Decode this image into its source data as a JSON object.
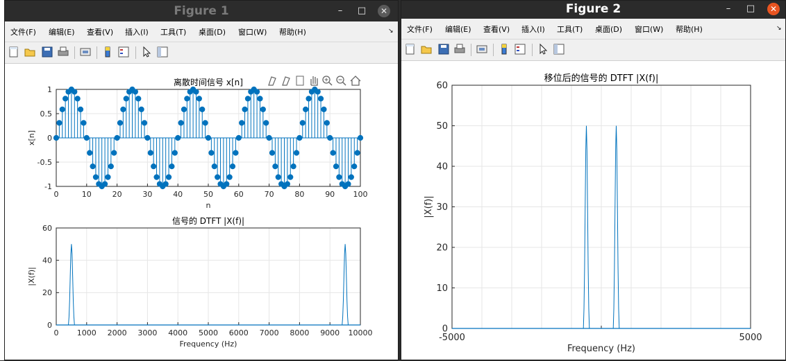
{
  "figure1": {
    "title": "Figure 1",
    "menu": [
      "文件(F)",
      "编辑(E)",
      "查看(V)",
      "插入(I)",
      "工具(T)",
      "桌面(D)",
      "窗口(W)",
      "帮助(H)"
    ],
    "toolbar_icons": [
      "new-figure-icon",
      "open-file-icon",
      "save-icon",
      "print-icon",
      "link-icon",
      "colorbar-icon",
      "legend-icon",
      "pointer-icon",
      "property-editor-icon"
    ],
    "axes_toolbar_icons": [
      "brush-icon",
      "data-tip-icon",
      "export-icon",
      "pan-icon",
      "zoom-in-icon",
      "zoom-out-icon",
      "home-icon"
    ],
    "title_color": "#7a7a7a"
  },
  "figure2": {
    "title": "Figure 2",
    "menu": [
      "文件(F)",
      "编辑(E)",
      "查看(V)",
      "插入(I)",
      "工具(T)",
      "桌面(D)",
      "窗口(W)",
      "帮助(H)"
    ],
    "toolbar_icons": [
      "new-figure-icon",
      "open-file-icon",
      "save-icon",
      "print-icon",
      "link-icon",
      "colorbar-icon",
      "legend-icon",
      "pointer-icon",
      "property-editor-icon"
    ],
    "title_color": "#ffffff"
  },
  "chart_data": [
    {
      "type": "stem",
      "title": "离散时间信号 x[n]",
      "xlabel": "n",
      "ylabel": "x[n]",
      "xlim": [
        0,
        100
      ],
      "ylim": [
        -1,
        1
      ],
      "xticks": [
        0,
        10,
        20,
        30,
        40,
        50,
        60,
        70,
        80,
        90,
        100
      ],
      "yticks": [
        -1,
        -0.5,
        0,
        0.5,
        1
      ],
      "ytick_labels": [
        "-1",
        "-0.5",
        "0",
        "0.5",
        "1"
      ],
      "signal": "sin(2*pi*0.05*n)",
      "x": [
        0,
        1,
        2,
        3,
        4,
        5,
        6,
        7,
        8,
        9,
        10,
        11,
        12,
        13,
        14,
        15,
        16,
        17,
        18,
        19,
        20,
        21,
        22,
        23,
        24,
        25,
        26,
        27,
        28,
        29,
        30,
        31,
        32,
        33,
        34,
        35,
        36,
        37,
        38,
        39,
        40,
        41,
        42,
        43,
        44,
        45,
        46,
        47,
        48,
        49,
        50,
        51,
        52,
        53,
        54,
        55,
        56,
        57,
        58,
        59,
        60,
        61,
        62,
        63,
        64,
        65,
        66,
        67,
        68,
        69,
        70,
        71,
        72,
        73,
        74,
        75,
        76,
        77,
        78,
        79,
        80,
        81,
        82,
        83,
        84,
        85,
        86,
        87,
        88,
        89,
        90,
        91,
        92,
        93,
        94,
        95,
        96,
        97,
        98,
        99,
        100
      ],
      "color": "#0072BD"
    },
    {
      "type": "line",
      "title": "信号的 DTFT |X(f)|",
      "xlabel": "Frequency (Hz)",
      "ylabel": "|X(f)|",
      "xlim": [
        0,
        10000
      ],
      "ylim": [
        0,
        60
      ],
      "xticks": [
        0,
        1000,
        2000,
        3000,
        4000,
        5000,
        6000,
        7000,
        8000,
        9000,
        10000
      ],
      "yticks": [
        0,
        20,
        40,
        60
      ],
      "x": [
        0,
        400,
        420,
        440,
        460,
        480,
        500,
        520,
        540,
        560,
        580,
        600,
        10000,
        9400,
        9420,
        9440,
        9460,
        9480,
        9500,
        9520,
        9540,
        9560,
        9580,
        9600
      ],
      "peaks": [
        {
          "x": [
            400,
            420,
            440,
            460,
            480,
            500,
            520,
            540,
            560,
            580,
            600
          ],
          "y": [
            0,
            5,
            15,
            30,
            44,
            50,
            44,
            30,
            15,
            5,
            0
          ]
        },
        {
          "x": [
            9400,
            9420,
            9440,
            9460,
            9480,
            9500,
            9520,
            9540,
            9560,
            9580,
            9600
          ],
          "y": [
            0,
            5,
            15,
            30,
            44,
            50,
            44,
            30,
            15,
            5,
            0
          ]
        }
      ],
      "color": "#0072BD"
    },
    {
      "type": "line",
      "title": "移位后的信号的 DTFT |X(f)|",
      "xlabel": "Frequency (Hz)",
      "ylabel": "|X(f)|",
      "xlim": [
        -5000,
        5000
      ],
      "ylim": [
        0,
        60
      ],
      "xticks": [
        -5000,
        0,
        5000
      ],
      "xtick_labels": [
        "-5000",
        "",
        "5000"
      ],
      "xticks_minor": [
        -5000,
        -4000,
        -3000,
        -2000,
        -1000,
        0,
        1000,
        2000,
        3000,
        4000,
        5000
      ],
      "yticks": [
        0,
        10,
        20,
        30,
        40,
        50,
        60
      ],
      "peaks": [
        {
          "x": [
            -600,
            -580,
            -560,
            -540,
            -520,
            -500,
            -480,
            -460,
            -440,
            -420,
            -400
          ],
          "y": [
            0,
            5,
            15,
            30,
            44,
            50,
            44,
            30,
            15,
            5,
            0
          ]
        },
        {
          "x": [
            400,
            420,
            440,
            460,
            480,
            500,
            520,
            540,
            560,
            580,
            600
          ],
          "y": [
            0,
            5,
            15,
            30,
            44,
            50,
            44,
            30,
            15,
            5,
            0
          ]
        }
      ],
      "color": "#0072BD"
    }
  ]
}
